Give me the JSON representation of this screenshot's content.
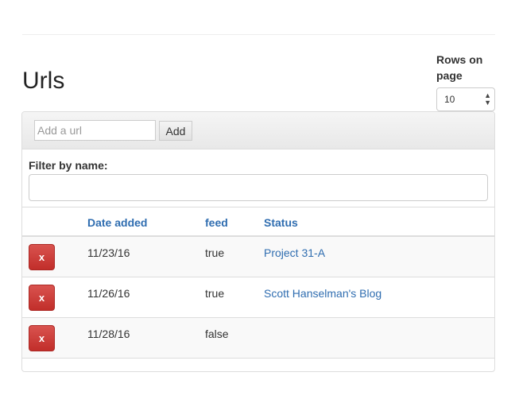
{
  "header": {
    "title": "Urls",
    "rows_label": "Rows on page",
    "rows_value": "10"
  },
  "add_form": {
    "placeholder": "Add a url",
    "add_label": "Add"
  },
  "filter": {
    "label": "Filter by name:",
    "value": ""
  },
  "table": {
    "columns": [
      "Date added",
      "feed",
      "Status"
    ],
    "rows": [
      {
        "delete_label": "x",
        "date": "11/23/16",
        "feed": "true",
        "status": "Project 31-A"
      },
      {
        "delete_label": "x",
        "date": "11/26/16",
        "feed": "true",
        "status": "Scott Hanselman's Blog"
      },
      {
        "delete_label": "x",
        "date": "11/28/16",
        "feed": "false",
        "status": ""
      }
    ]
  },
  "colors": {
    "link": "#2f6db0",
    "danger": "#d9534f"
  }
}
